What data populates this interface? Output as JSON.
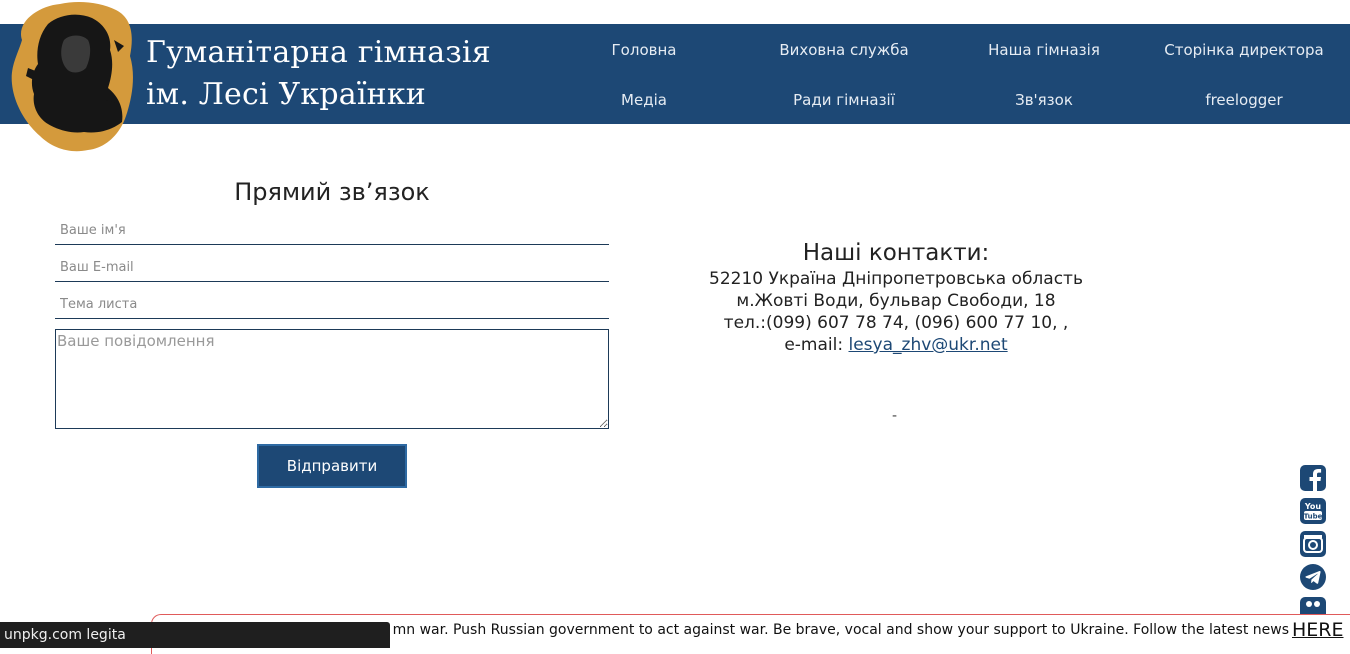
{
  "header": {
    "title_line1": "Гуманітарна гімназія",
    "title_line2": "ім. Лесі Українки",
    "nav": [
      {
        "label": "Головна"
      },
      {
        "label": "Виховна служба"
      },
      {
        "label": "Наша гімназія"
      },
      {
        "label": "Сторінка директора"
      },
      {
        "label": "Медіа"
      },
      {
        "label": "Ради гімназії"
      },
      {
        "label": "Зв'язок"
      },
      {
        "label": "freelogger"
      }
    ],
    "background": "#1d4875"
  },
  "form": {
    "title": "Прямий зв’язок",
    "name_placeholder": "Ваше ім'я",
    "email_placeholder": "Ваш E-mail",
    "subject_placeholder": "Тема листа",
    "message_placeholder": "Ваше повідомлення",
    "submit_label": "Відправити"
  },
  "contacts": {
    "title": "Наші контакти:",
    "address_line1": "52210 Україна Дніпропетровська область",
    "address_line2": "м.Жовті Води, бульвар Свободи, 18",
    "phones": "тел.:(099) 607 78 74, (096) 600 77 10, ,",
    "email_label": "e-mail: ",
    "email": "lesya_zhv@ukr.net",
    "dash": "-"
  },
  "social": [
    "facebook-icon",
    "youtube-icon",
    "instagram-icon",
    "telegram-icon",
    "viber-icon"
  ],
  "banner": {
    "text": "mn war. Push Russian government to act against war. Be brave, vocal and show your support to Ukraine. Follow the latest news",
    "link": "HERE"
  },
  "status_bar": {
    "text": "unpkg.com legita"
  }
}
